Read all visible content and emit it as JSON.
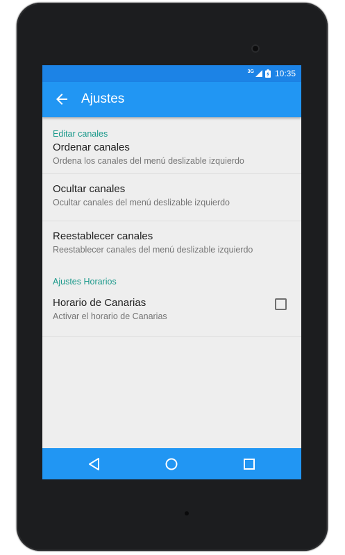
{
  "status_bar": {
    "network_label": "3G",
    "time": "10:35",
    "icons": [
      "signal-icon",
      "battery-icon"
    ]
  },
  "app_bar": {
    "title": "Ajustes",
    "back_icon": "arrow-back-icon"
  },
  "settings": {
    "categories": [
      {
        "title": "Editar canales",
        "items": [
          {
            "title": "Ordenar canales",
            "summary": "Ordena los canales del menú deslizable izquierdo"
          },
          {
            "title": "Ocultar canales",
            "summary": "Ocultar canales del menú deslizable izquierdo"
          },
          {
            "title": "Reestablecer canales",
            "summary": "Reestablecer canales del menú deslizable izquierdo"
          }
        ]
      },
      {
        "title": "Ajustes Horarios",
        "items": [
          {
            "title": "Horario de Canarias",
            "summary": "Activar el horario de Canarias",
            "checkbox": false
          }
        ]
      }
    ]
  },
  "nav_bar": {
    "buttons": [
      "nav-back-icon",
      "nav-home-icon",
      "nav-recents-icon"
    ]
  },
  "colors": {
    "primary": "#2196f3",
    "primary_dark": "#1c83e6",
    "accent": "#1b998b",
    "background": "#eeeeee"
  }
}
